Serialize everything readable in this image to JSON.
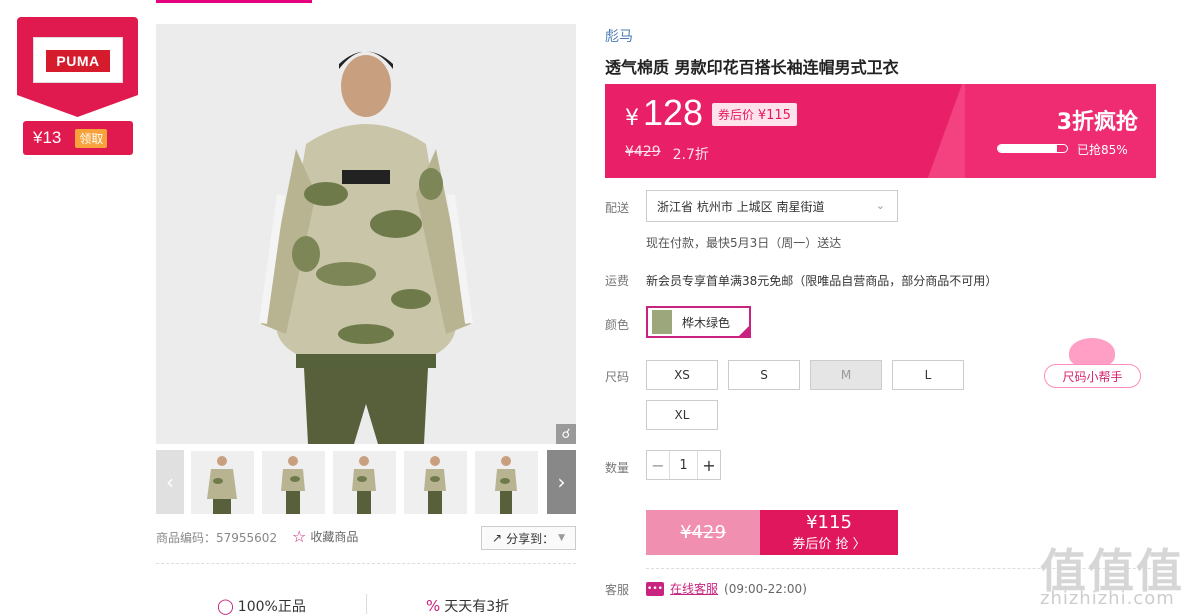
{
  "brand": {
    "logo_text": "PUMA",
    "coupon_amount": "¥13",
    "coupon_button": "领取"
  },
  "gallery": {
    "zoom_icon": "magnifier-icon",
    "prev_icon": "chevron-left-icon",
    "next_icon": "chevron-right-icon",
    "thumbnails": [
      "thumb-1",
      "thumb-2",
      "thumb-3",
      "thumb-4",
      "thumb-5"
    ]
  },
  "meta": {
    "code": "商品编码：57955602",
    "favorite": "收藏商品",
    "share": "分享到："
  },
  "promises": [
    "100%正品",
    "天天有3折"
  ],
  "product": {
    "brand": "彪马",
    "title": "透气棉质 男款印花百搭长袖连帽男式卫衣"
  },
  "price": {
    "currency": "¥",
    "current": "128",
    "coupon_label": "券后价",
    "coupon_price": "¥115",
    "original": "¥429",
    "discount": "2.7折",
    "flash_title": "3折疯抢",
    "sold_percent": 85,
    "sold_text": "已抢85%"
  },
  "delivery": {
    "label": "配送",
    "address": "浙江省 杭州市 上城区 南星街道",
    "note": "现在付款，最快5月3日（周一）送达"
  },
  "shipping": {
    "label": "运费",
    "note": "新会员专享首单满38元免邮（限唯品自营商品，部分商品不可用）"
  },
  "color": {
    "label": "颜色",
    "selected": "桦木绿色"
  },
  "size": {
    "label": "尺码",
    "options": [
      "XS",
      "S",
      "M",
      "L",
      "XL"
    ],
    "disabled": "M",
    "helper": "尺码小帮手"
  },
  "quantity": {
    "label": "数量",
    "value": "1"
  },
  "buy": {
    "original": "¥429",
    "price": "¥115",
    "action": "券后价 抢 〉"
  },
  "service": {
    "label": "客服",
    "link": "在线客服",
    "hours": "(09:00-22:00)"
  },
  "watermark": {
    "main": "值值值",
    "sub": "zhizhizhi.com"
  },
  "colors": {
    "accent": "#e91f67",
    "brand_red": "#e0194f",
    "link_blue": "#4a7bb7"
  }
}
